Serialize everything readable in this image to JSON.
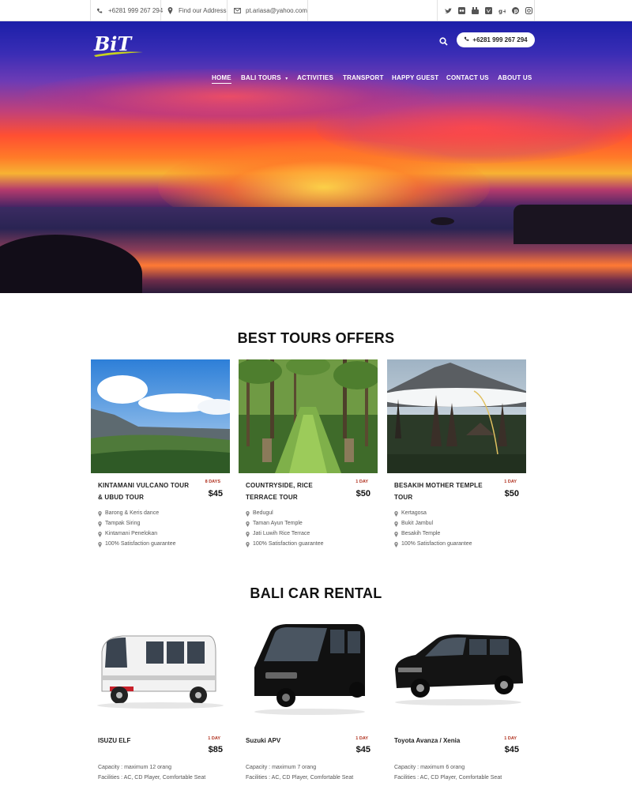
{
  "topbar": {
    "phone": "+6281 999 267 294",
    "address": "Find our Address",
    "email": "pt.ariasa@yahoo.com",
    "social_icons": [
      "twitter-icon",
      "flickr-icon",
      "youtube-icon",
      "vimeo-icon",
      "google-plus-icon",
      "pinterest-icon",
      "instagram-icon"
    ]
  },
  "header": {
    "logo_text": "BiT",
    "phone_button": "+6281 999 267 294",
    "nav": [
      "HOME",
      "BALI TOURS",
      "ACTIVITIES",
      "TRANSPORT",
      "HAPPY GUEST",
      "CONTACT US",
      "ABOUT US"
    ],
    "active_nav": "HOME"
  },
  "tours": {
    "title": "BEST TOURS OFFERS",
    "items": [
      {
        "name": "KINTAMANI VULCANO TOUR & UBUD TOUR",
        "duration": "8 DAYS",
        "price": "$45",
        "features": [
          "Barong & Keris dance",
          "Tampak Siring",
          "Kintamani Penelokan",
          "100% Satisfaction guarantee"
        ]
      },
      {
        "name": "COUNTRYSIDE, RICE TERRACE TOUR",
        "duration": "1 DAY",
        "price": "$50",
        "features": [
          "Bedugul",
          "Taman Ayun Temple",
          "Jati Luwih Rice Terrace",
          "100% Satisfaction guarantee"
        ]
      },
      {
        "name": "BESAKIH MOTHER TEMPLE TOUR",
        "duration": "1 DAY",
        "price": "$50",
        "features": [
          "Kertagosa",
          "Bukit Jambul",
          "Besakih Temple",
          "100% Satisfaction guarantee"
        ]
      }
    ]
  },
  "cars": {
    "title": "BALI CAR RENTAL",
    "items": [
      {
        "name": "ISUZU ELF",
        "duration": "1 DAY",
        "price": "$85",
        "capacity": "Capacity : maximum 12 orang",
        "facilities": "Facilities : AC, CD Player, Comfortable Seat"
      },
      {
        "name": "Suzuki APV",
        "duration": "1 DAY",
        "price": "$45",
        "capacity": "Capacity : maximum 7 orang",
        "facilities": "Facilities : AC, CD Player, Comfortable Seat"
      },
      {
        "name": "Toyota Avanza / Xenia",
        "duration": "1 DAY",
        "price": "$45",
        "capacity": "Capacity : maximum 6 orang",
        "facilities": "Facilities : AC, CD Player, Comfortable Seat"
      }
    ]
  },
  "colors": {
    "accent": "#b0301e",
    "nav_text": "#ffffff",
    "logo_yellow": "#c8d21e"
  }
}
